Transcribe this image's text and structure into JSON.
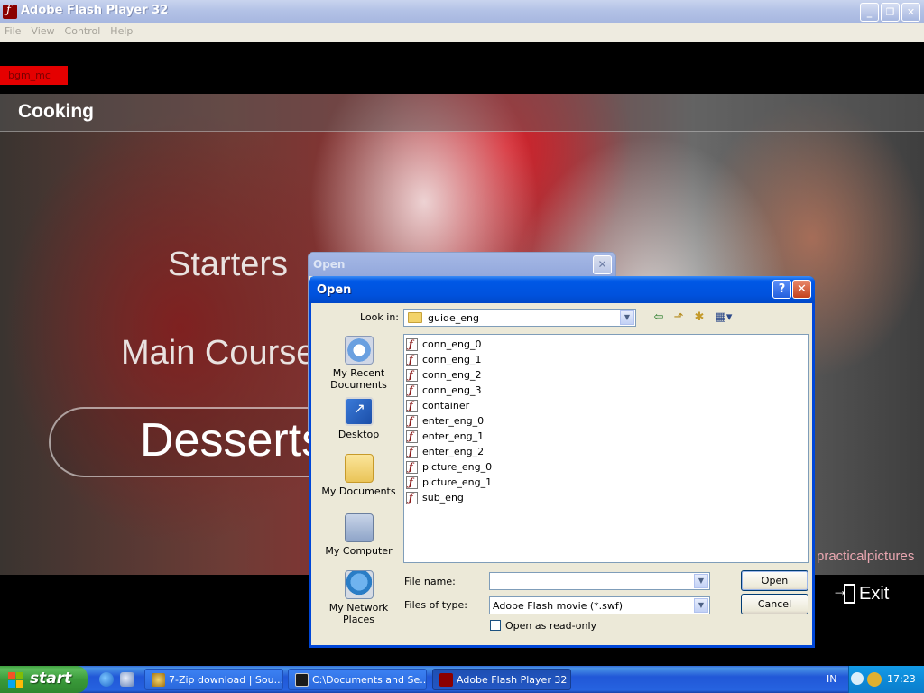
{
  "window": {
    "title": "Adobe Flash Player 32"
  },
  "menubar": {
    "items": [
      "File",
      "View",
      "Control",
      "Help"
    ]
  },
  "flash": {
    "bgm_label": "bgm_mc",
    "header": "Cooking",
    "menu": {
      "starters": "Starters",
      "main": "Main Course",
      "desserts": "Desserts"
    },
    "brand": "practicalpictures",
    "exit": "Exit"
  },
  "dialog_back": {
    "title": "Open"
  },
  "dialog": {
    "title": "Open",
    "look_in_label": "Look in:",
    "look_in_value": "guide_eng",
    "places": [
      {
        "label": "My Recent\nDocuments",
        "icon": "recent-documents-icon"
      },
      {
        "label": "Desktop",
        "icon": "desktop-icon"
      },
      {
        "label": "My Documents",
        "icon": "my-documents-icon"
      },
      {
        "label": "My Computer",
        "icon": "my-computer-icon"
      },
      {
        "label": "My Network\nPlaces",
        "icon": "network-places-icon"
      }
    ],
    "files": [
      "conn_eng_0",
      "conn_eng_1",
      "conn_eng_2",
      "conn_eng_3",
      "container",
      "enter_eng_0",
      "enter_eng_1",
      "enter_eng_2",
      "picture_eng_0",
      "picture_eng_1",
      "sub_eng"
    ],
    "file_name_label": "File name:",
    "file_name_value": "",
    "files_of_type_label": "Files of type:",
    "files_of_type_value": "Adobe Flash movie (*.swf)",
    "read_only_label": "Open as read-only",
    "open_button": "Open",
    "cancel_button": "Cancel"
  },
  "taskbar": {
    "start": "start",
    "tasks": [
      {
        "label": "7-Zip download | Sou...",
        "active": false
      },
      {
        "label": "C:\\Documents and Se...",
        "active": false
      },
      {
        "label": "Adobe Flash Player 32",
        "active": true
      }
    ],
    "lang": "IN",
    "clock": "17:23"
  },
  "colors": {
    "xp_blue": "#0054e3",
    "flash_red": "#e50000",
    "dialog_bg": "#ece9d8"
  }
}
